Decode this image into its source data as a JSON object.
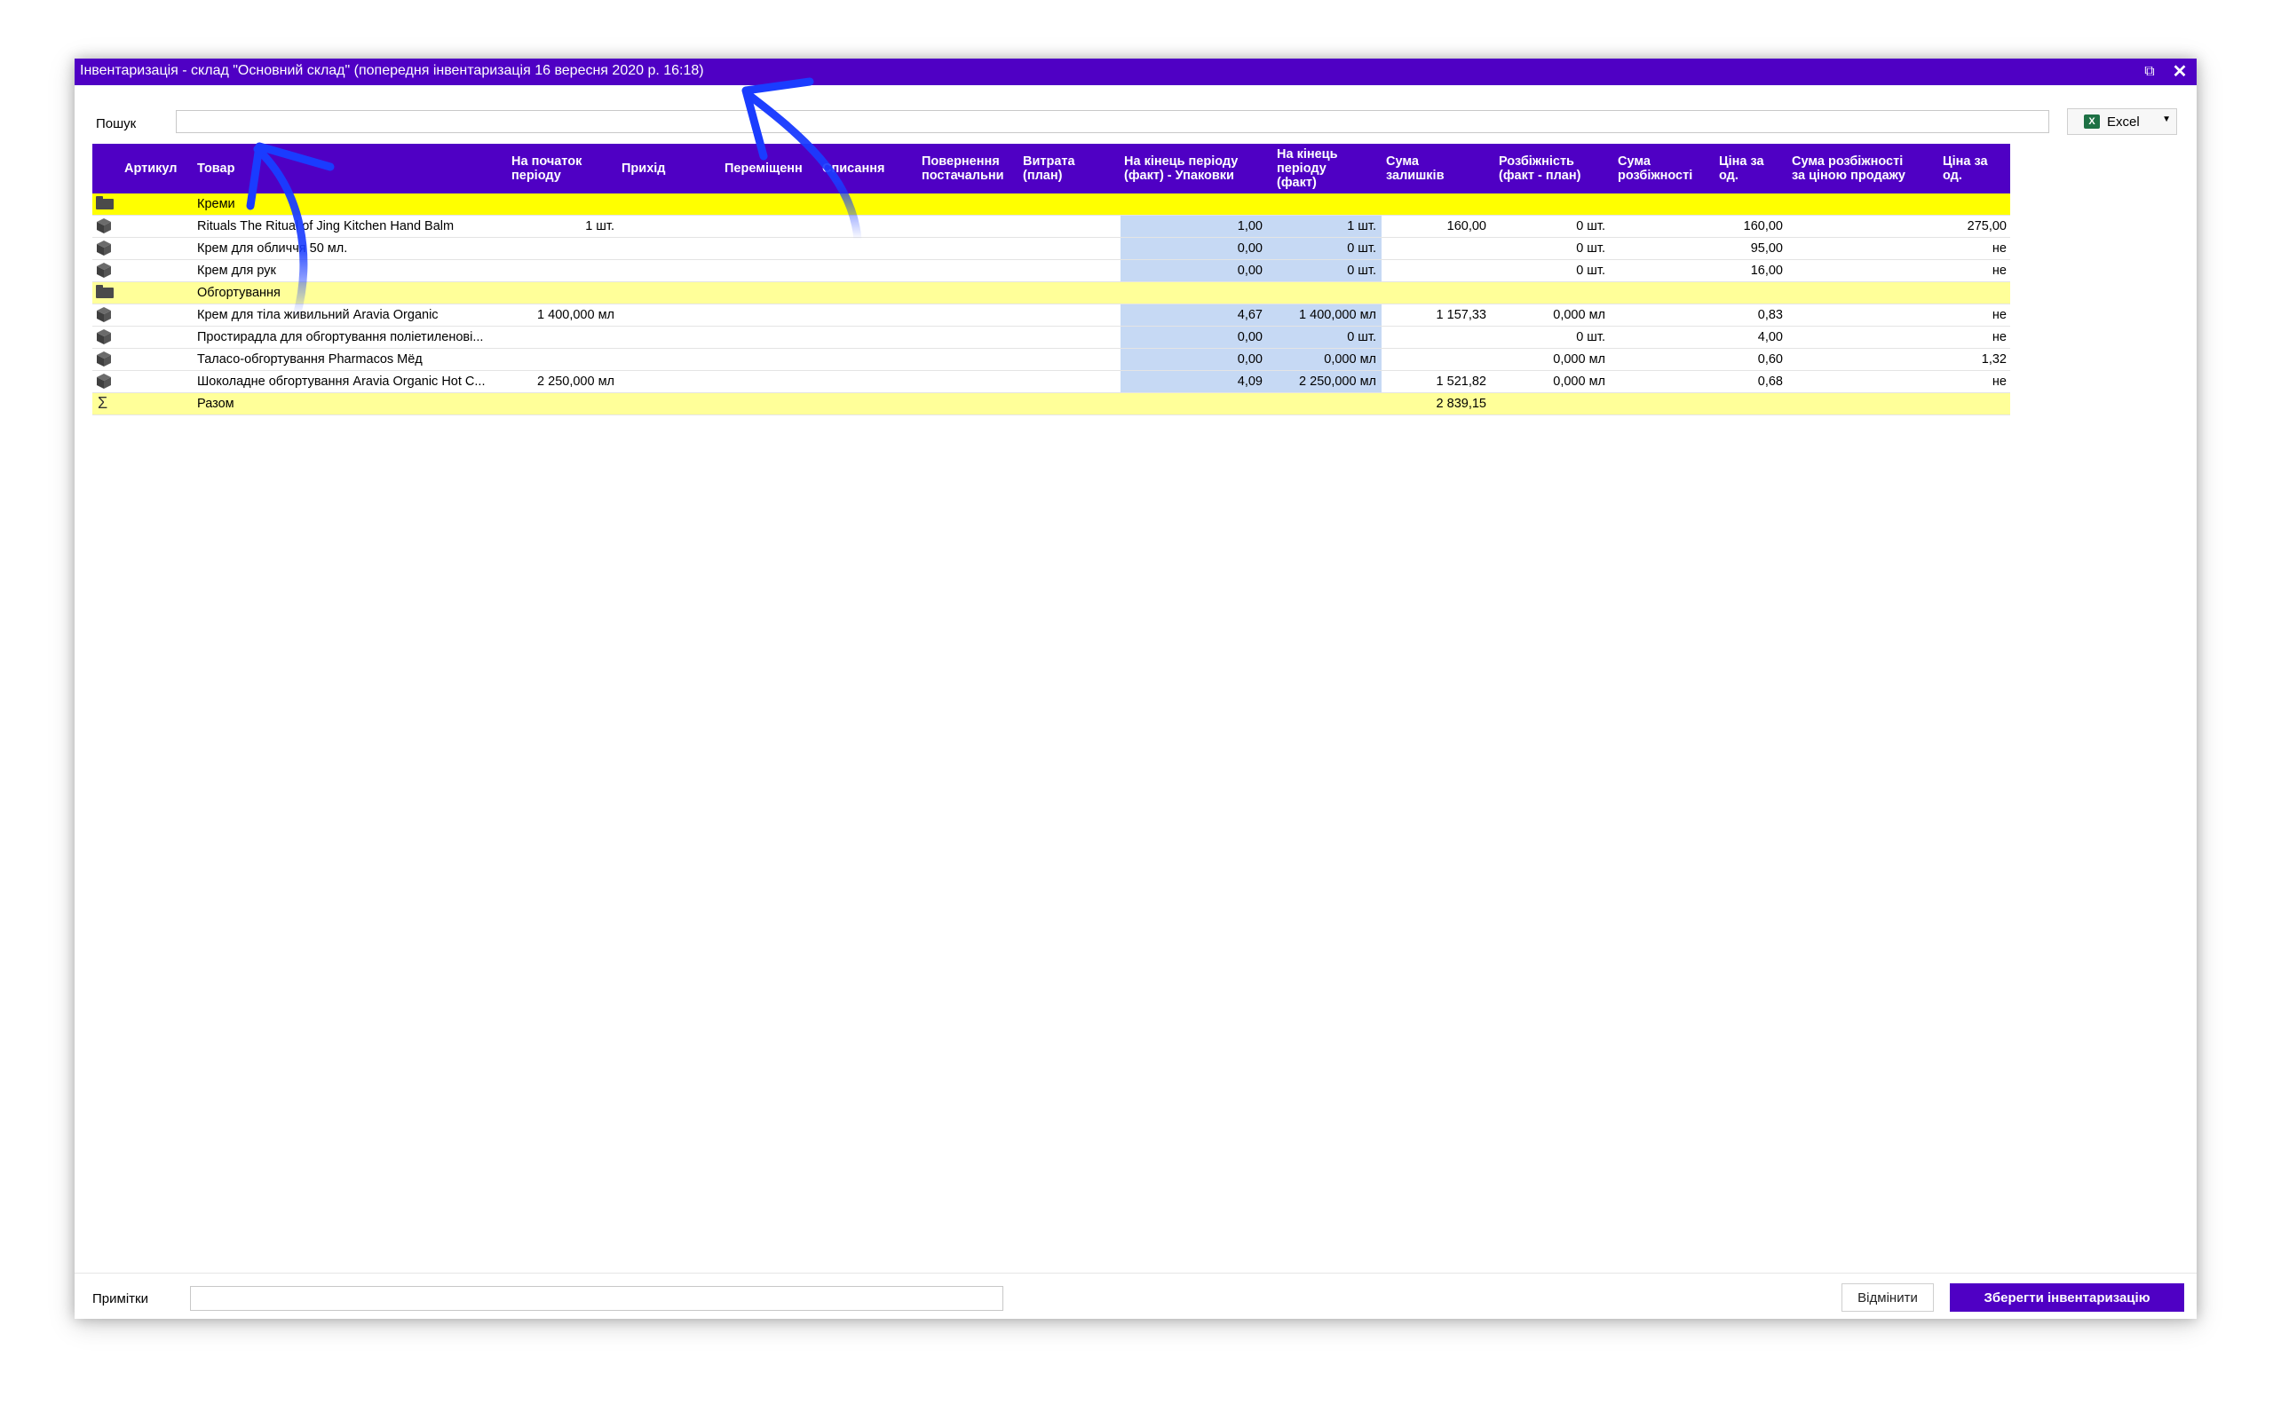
{
  "window": {
    "title": "Інвентаризація - склад \"Основний склад\" (попередня інвентаризація 16 вересня 2020 р. 16:18)",
    "restore_icon": "restore-icon",
    "close_icon": "close-icon",
    "accent_color": "#4f00c4"
  },
  "search": {
    "label": "Пошук",
    "value": "",
    "placeholder": ""
  },
  "export": {
    "label": "Excel",
    "icon": "excel-icon"
  },
  "grid": {
    "columns": [
      "Артикул",
      "Товар",
      "На початок\nперіоду",
      "Прихід",
      "Переміщенн",
      "Списання",
      "Повернення\nпостачальни",
      "Витрата\n(план)",
      "На кінець періоду\n(факт) - Упаковки",
      "На кінець\nперіоду\n(факт)",
      "Сума\nзалишків",
      "Розбіжність\n(факт - план)",
      "Сума\nрозбіжності",
      "Ціна за\nод.",
      "Сума розбіжності\nза ціною продажу",
      "Ціна за\nод."
    ],
    "rows": [
      {
        "type": "group",
        "style": "yellow",
        "name": "Креми"
      },
      {
        "type": "item",
        "name": "Rituals The Ritual of Jing Kitchen Hand Balm",
        "start": "1 шт.",
        "packs": "1,00",
        "fact": "1 шт.",
        "sum_rest": "160,00",
        "diff": "0 шт.",
        "price": "160,00",
        "price2": "275,00"
      },
      {
        "type": "item",
        "name": "Крем для обличчя 50 мл.",
        "start": "",
        "packs": "0,00",
        "fact": "0 шт.",
        "sum_rest": "",
        "diff": "0 шт.",
        "price": "95,00",
        "price2": "не"
      },
      {
        "type": "item",
        "name": "Крем для рук",
        "start": "",
        "packs": "0,00",
        "fact": "0 шт.",
        "sum_rest": "",
        "diff": "0 шт.",
        "price": "16,00",
        "price2": "не"
      },
      {
        "type": "group",
        "style": "pale",
        "name": "Обгортування"
      },
      {
        "type": "item",
        "name": "Крем для тіла живильний Aravia Organic",
        "start": "1 400,000 мл",
        "packs": "4,67",
        "fact": "1 400,000 мл",
        "sum_rest": "1 157,33",
        "diff": "0,000 мл",
        "price": "0,83",
        "price2": "не"
      },
      {
        "type": "item",
        "name": "Простирадла для обгортування поліетиленові...",
        "start": "",
        "packs": "0,00",
        "fact": "0 шт.",
        "sum_rest": "",
        "diff": "0 шт.",
        "price": "4,00",
        "price2": "не"
      },
      {
        "type": "item",
        "name": "Таласо-обгортування Pharmacos Мёд",
        "start": "",
        "packs": "0,00",
        "fact": "0,000 мл",
        "sum_rest": "",
        "diff": "0,000 мл",
        "price": "0,60",
        "price2": "1,32"
      },
      {
        "type": "item",
        "name": "Шоколадне обгортування Aravia Organic Hot C...",
        "start": "2 250,000 мл",
        "packs": "4,09",
        "fact": "2 250,000 мл",
        "sum_rest": "1 521,82",
        "diff": "0,000 мл",
        "price": "0,68",
        "price2": "не"
      },
      {
        "type": "total",
        "name": "Разом",
        "sum_rest": "2 839,15"
      }
    ]
  },
  "footer": {
    "notes_label": "Примітки",
    "notes_value": "",
    "cancel_label": "Відмінити",
    "save_label": "Зберегти інвентаризацію"
  }
}
